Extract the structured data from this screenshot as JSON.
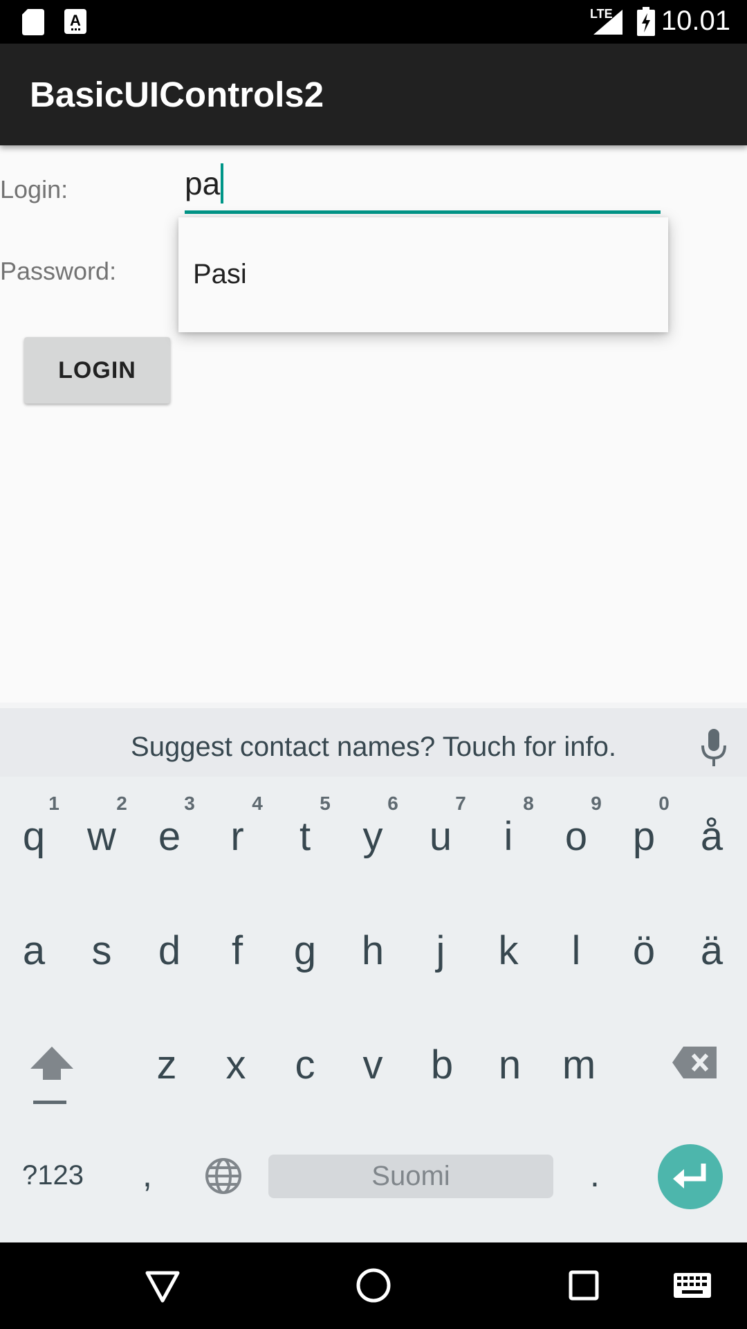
{
  "status_bar": {
    "time": "10.01",
    "network_label": "LTE",
    "icons": [
      "sd-card-icon",
      "a-notification-icon",
      "lte-signal-icon",
      "battery-charging-icon"
    ]
  },
  "app_bar": {
    "title": "BasicUIControls2"
  },
  "form": {
    "login_label": "Login:",
    "login_value": "pa",
    "password_label": "Password:",
    "login_button": "LOGIN",
    "suggestions": [
      "Pasi"
    ]
  },
  "keyboard": {
    "suggestion_text": "Suggest contact names? Touch for info.",
    "row1": [
      {
        "key": "q",
        "hint": "1"
      },
      {
        "key": "w",
        "hint": "2"
      },
      {
        "key": "e",
        "hint": "3"
      },
      {
        "key": "r",
        "hint": "4"
      },
      {
        "key": "t",
        "hint": "5"
      },
      {
        "key": "y",
        "hint": "6"
      },
      {
        "key": "u",
        "hint": "7"
      },
      {
        "key": "i",
        "hint": "8"
      },
      {
        "key": "o",
        "hint": "9"
      },
      {
        "key": "p",
        "hint": "0"
      },
      {
        "key": "å",
        "hint": ""
      }
    ],
    "row2": [
      "a",
      "s",
      "d",
      "f",
      "g",
      "h",
      "j",
      "k",
      "l",
      "ö",
      "ä"
    ],
    "row3": [
      "z",
      "x",
      "c",
      "v",
      "b",
      "n",
      "m"
    ],
    "symbols_key": "?123",
    "comma_key": ",",
    "space_label": "Suomi",
    "period_key": ".",
    "accent_color": "#4db6ac"
  },
  "nav_bar": {
    "icons": [
      "back-icon",
      "home-icon",
      "recents-icon",
      "keyboard-switch-icon"
    ]
  }
}
